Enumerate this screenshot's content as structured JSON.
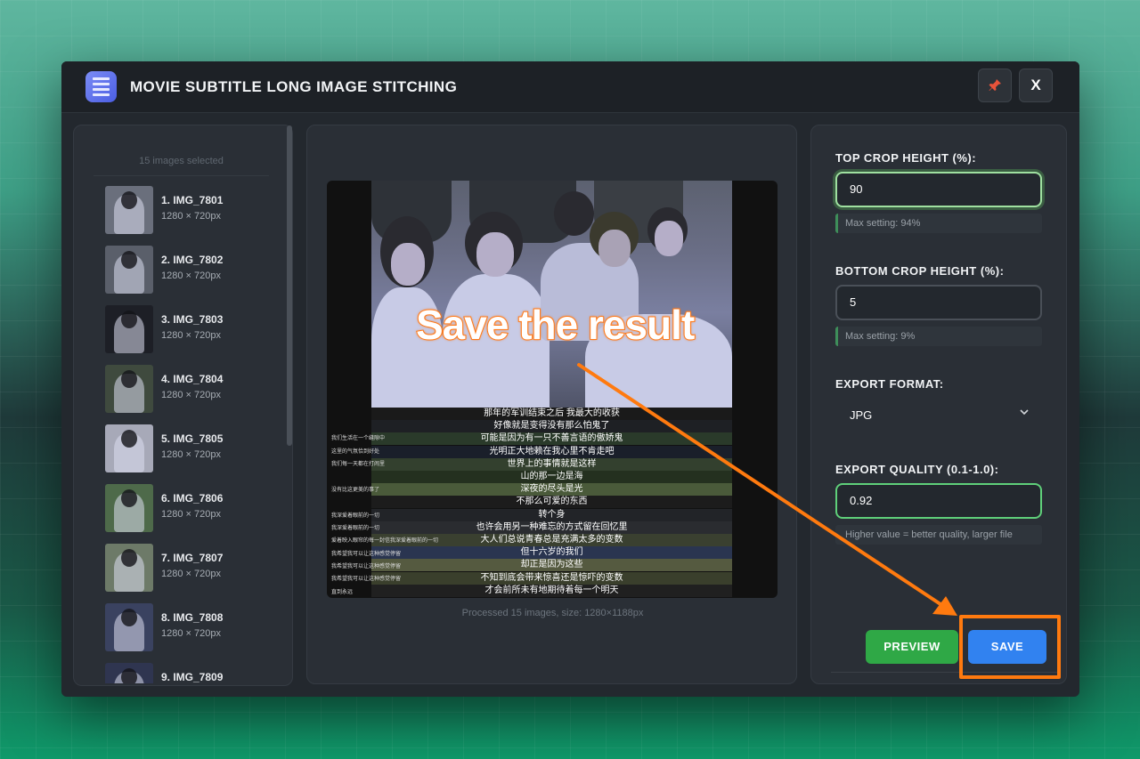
{
  "window": {
    "title": "MOVIE SUBTITLE LONG IMAGE STITCHING"
  },
  "toolbar": {
    "pin_icon": "pin-icon",
    "close_label": "X"
  },
  "sidebar": {
    "selected_count": "15 images selected",
    "items": [
      {
        "name": "1. IMG_7801",
        "size": "1280 × 720px",
        "thumb_color": "#6a6f7c"
      },
      {
        "name": "2. IMG_7802",
        "size": "1280 × 720px",
        "thumb_color": "#5a5f6a"
      },
      {
        "name": "3. IMG_7803",
        "size": "1280 × 720px",
        "thumb_color": "#1d1f26"
      },
      {
        "name": "4. IMG_7804",
        "size": "1280 × 720px",
        "thumb_color": "#3f4a3e"
      },
      {
        "name": "5. IMG_7805",
        "size": "1280 × 720px",
        "thumb_color": "#a7a9b8"
      },
      {
        "name": "6. IMG_7806",
        "size": "1280 × 720px",
        "thumb_color": "#4e6a4a"
      },
      {
        "name": "7. IMG_7807",
        "size": "1280 × 720px",
        "thumb_color": "#6d7a68"
      },
      {
        "name": "8. IMG_7808",
        "size": "1280 × 720px",
        "thumb_color": "#3a4260"
      },
      {
        "name": "9. IMG_7809",
        "size": "",
        "thumb_color": "#2f3550"
      }
    ]
  },
  "preview": {
    "overlay_text": "Save the result",
    "processed_info": "Processed 15 images, size: 1280×1188px",
    "subtitles": [
      "那年的军训结束之后 我最大的收获",
      "好像就是变得没有那么怕鬼了",
      "可能是因为有一只不善言语的傲娇鬼",
      "光明正大地赖在我心里不肯走吧",
      "世界上的事情就是这样",
      "山的那一边是海",
      "深夜的尽头是光",
      "不那么可爱的东西",
      "转个身",
      "也许会用另一种难忘的方式留在回忆里",
      "大人们总说青春总是充满太多的变数",
      "但十六岁的我们",
      "却正是因为这些",
      "不知到底会带来惊喜还是惊吓的变数",
      "才会前所未有地期待着每一个明天"
    ],
    "side_subtitles": [
      "我们生活在一个缝隙中",
      "这里的气氛恰到好处",
      "我们每一天都在打闹里",
      "没有比这更美的事了",
      "我深爱着眼前的一切",
      "我深爱着眼前的一切",
      "爱着映入眼帘的每一封信我深爱着眼前的一切",
      "我希望我可以让这种感觉停留",
      "我希望我可以让这种感觉停留",
      "我希望我可以让这种感觉停留",
      "直到永远"
    ]
  },
  "settings": {
    "top_crop": {
      "label": "TOP CROP HEIGHT (%):",
      "value": "90",
      "hint": "Max setting: 94%"
    },
    "bottom_crop": {
      "label": "BOTTOM CROP HEIGHT (%):",
      "value": "5",
      "hint": "Max setting: 9%"
    },
    "export_format": {
      "label": "EXPORT FORMAT:",
      "value": "JPG"
    },
    "export_quality": {
      "label": "EXPORT QUALITY (0.1-1.0):",
      "value": "0.92",
      "hint": "Higher value = better quality, larger file"
    }
  },
  "actions": {
    "preview_label": "PREVIEW",
    "save_label": "SAVE"
  },
  "colors": {
    "accent_orange": "#ff7a0f",
    "save_blue": "#3182f0",
    "preview_green": "#2fa846"
  }
}
